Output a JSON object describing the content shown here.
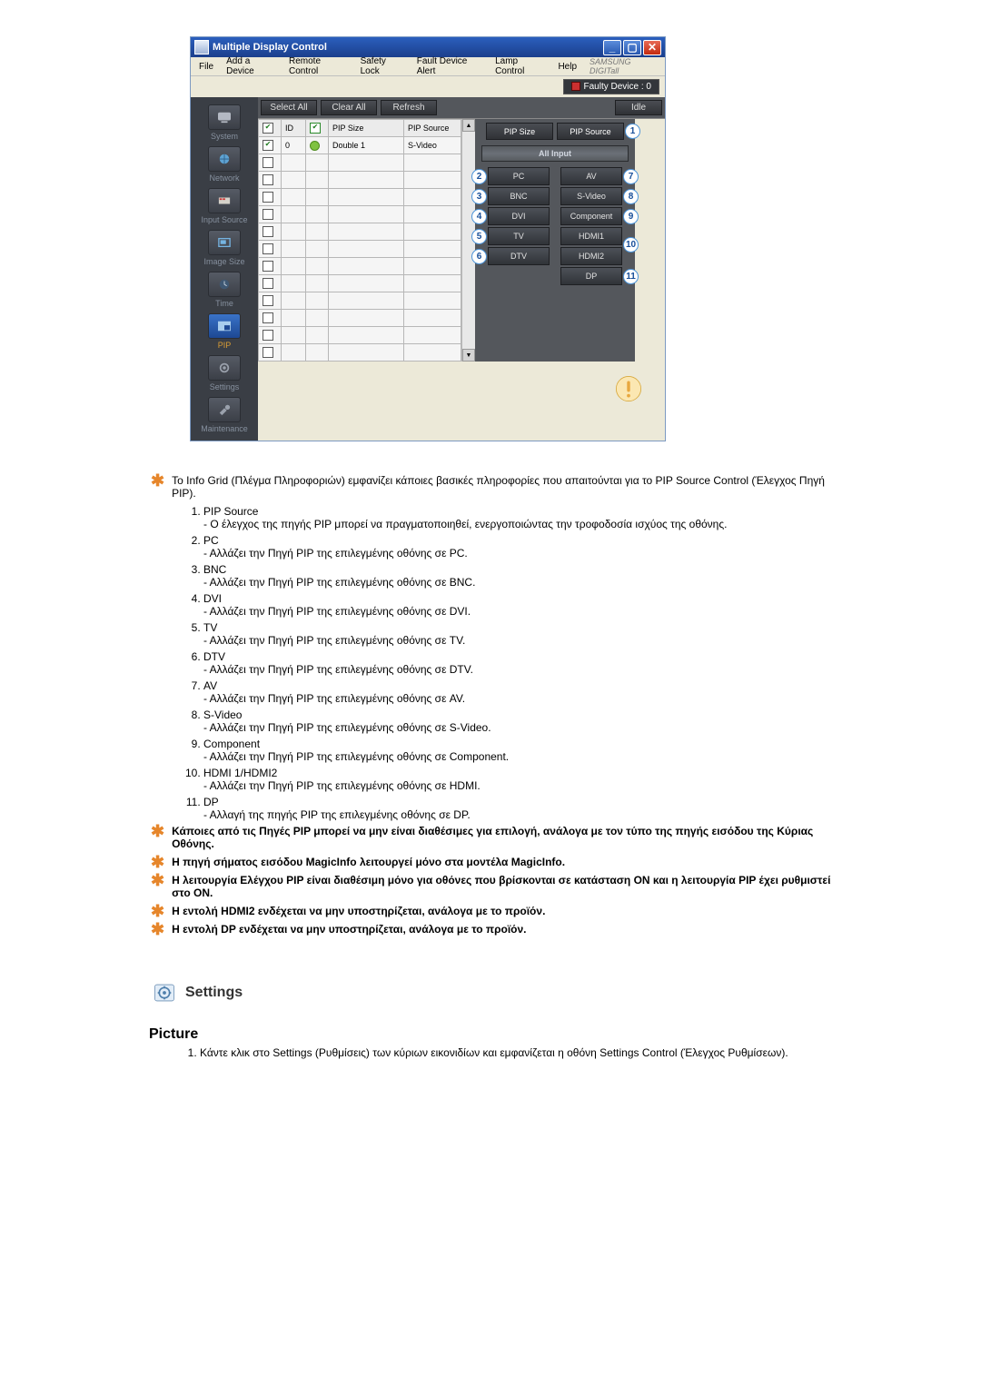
{
  "app": {
    "title": "Multiple Display Control",
    "menus": [
      "File",
      "Add a Device",
      "Remote Control",
      "Safety Lock",
      "Fault Device Alert",
      "Lamp Control",
      "Help"
    ],
    "brand": "SAMSUNG DIGITall",
    "faulty": "Faulty Device : 0",
    "toolbar": {
      "select": "Select All",
      "clear": "Clear All",
      "refresh": "Refresh",
      "idle": "Idle"
    },
    "sidebar": [
      "System",
      "Network",
      "Input Source",
      "Image Size",
      "Time",
      "PIP",
      "Settings",
      "Maintenance"
    ],
    "gridHeaders": {
      "id": "ID",
      "pipSize": "PIP Size",
      "pipSource": "PIP Source"
    },
    "row0": {
      "id": "0",
      "pipSize": "Double 1",
      "pipSource": "S-Video"
    },
    "right": {
      "pipSize": "PIP Size",
      "pipSource": "PIP Source",
      "allInput": "All Input",
      "left": [
        "PC",
        "BNC",
        "DVI",
        "TV",
        "DTV"
      ],
      "rightCol": [
        "AV",
        "S-Video",
        "Component",
        "HDMI1",
        "HDMI2",
        "DP"
      ]
    }
  },
  "info": "Το Info Grid (Πλέγμα Πληροφοριών) εμφανίζει κάποιες βασικές πληροφορίες που απαιτούνται για το PIP Source Control (Έλεγχος Πηγή PIP).",
  "list": [
    {
      "t": "PIP Source",
      "d": "- Ο έλεγχος της πηγής PIP μπορεί να πραγματοποιηθεί, ενεργοποιώντας την τροφοδοσία ισχύος της οθόνης."
    },
    {
      "t": "PC",
      "d": "- Αλλάζει την Πηγή PIP της επιλεγμένης οθόνης σε PC."
    },
    {
      "t": "BNC",
      "d": "- Αλλάζει την Πηγή PIP της επιλεγμένης οθόνης σε BNC."
    },
    {
      "t": "DVI",
      "d": "- Αλλάζει την Πηγή PIP της επιλεγμένης οθόνης σε DVI."
    },
    {
      "t": "TV",
      "d": "- Αλλάζει την Πηγή PIP της επιλεγμένης οθόνης σε TV."
    },
    {
      "t": "DTV",
      "d": "- Αλλάζει την Πηγή PIP της επιλεγμένης οθόνης σε DTV."
    },
    {
      "t": "AV",
      "d": "- Αλλάζει την Πηγή PIP της επιλεγμένης οθόνης σε AV."
    },
    {
      "t": "S-Video",
      "d": "- Αλλάζει την Πηγή PIP της επιλεγμένης οθόνης σε S-Video."
    },
    {
      "t": "Component",
      "d": "- Αλλάζει την Πηγή PIP της επιλεγμένης οθόνης σε Component."
    },
    {
      "t": "HDMI 1/HDMI2",
      "d": "- Αλλάζει την Πηγή PIP της επιλεγμένης οθόνης σε HDMI."
    },
    {
      "t": "DP",
      "d": "- Αλλαγή της πηγής PIP της επιλεγμένης οθόνης σε DP."
    }
  ],
  "warnings": [
    "Κάποιες από τις Πηγές PIP μπορεί να μην είναι διαθέσιμες για επιλογή, ανάλογα με τον τύπο της πηγής εισόδου της Κύριας Οθόνης.",
    "Η πηγή σήματος εισόδου MagicInfo λειτουργεί μόνο στα μοντέλα MagicInfo.",
    "Η λειτουργία Ελέγχου PIP είναι διαθέσιμη μόνο για οθόνες που βρίσκονται σε κατάσταση ON και η λειτουργία PIP έχει ρυθμιστεί στο ON.",
    "Η εντολή HDMI2 ενδέχεται να μην υποστηρίζεται, ανάλογα με το προϊόν.",
    "Η εντολή DP ενδέχεται να μην υποστηρίζεται, ανάλογα με το προϊόν."
  ],
  "settingsTitle": "Settings",
  "pictureTitle": "Picture",
  "pictureStep": "Κάντε κλικ στο Settings (Ρυθμίσεις) των κύριων εικονιδίων και εμφανίζεται η οθόνη Settings Control (Έλεγχος Ρυθμίσεων)."
}
